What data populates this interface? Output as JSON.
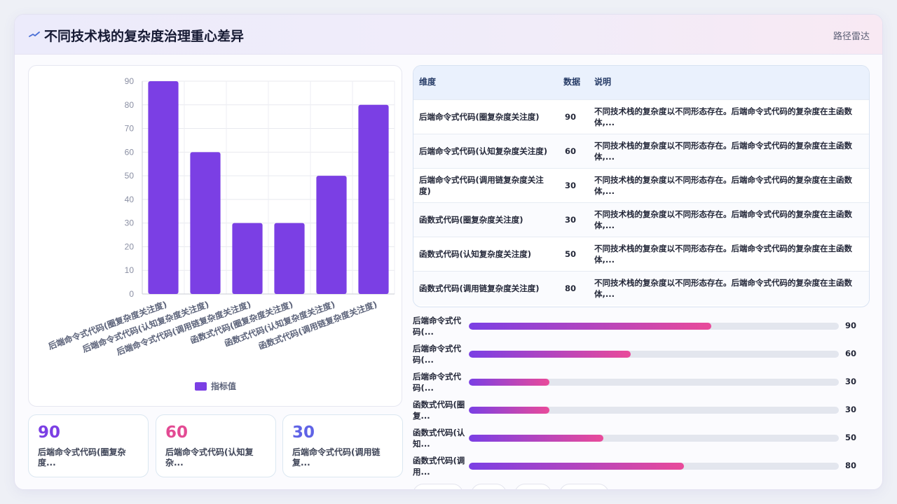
{
  "header": {
    "title": "不同技术栈的复杂度治理重心差异",
    "tag": "路径雷达"
  },
  "chart_data": {
    "type": "bar",
    "categories": [
      "后端命令式代码(圈复杂度关注度)",
      "后端命令式代码(认知复杂度关注度)",
      "后端命令式代码(调用链复杂度关注度)",
      "函数式代码(圈复杂度关注度)",
      "函数式代码(认知复杂度关注度)",
      "函数式代码(调用链复杂度关注度)"
    ],
    "series": [
      {
        "name": "指标值",
        "values": [
          90,
          60,
          30,
          30,
          50,
          80
        ]
      }
    ],
    "ylim": [
      0,
      90
    ],
    "yticks": [
      0,
      10,
      20,
      30,
      40,
      50,
      60,
      70,
      80,
      90
    ],
    "grid": true,
    "legend_position": "bottom",
    "bar_color": "#7b3fe4"
  },
  "stats": [
    {
      "value": "90",
      "label": "后端命令式代码(圈复杂度...",
      "color": "#7b3fe4"
    },
    {
      "value": "60",
      "label": "后端命令式代码(认知复杂...",
      "color": "#e34a93"
    },
    {
      "value": "30",
      "label": "后端命令式代码(调用链复...",
      "color": "#5f63e6"
    }
  ],
  "table": {
    "headers": {
      "dimension": "维度",
      "data": "数据",
      "description": "说明"
    },
    "rows": [
      {
        "dimension": "后端命令式代码(圈复杂度关注度)",
        "value": "90",
        "description": "不同技术栈的复杂度以不同形态存在。后端命令式代码的复杂度在主函数体,..."
      },
      {
        "dimension": "后端命令式代码(认知复杂度关注度)",
        "value": "60",
        "description": "不同技术栈的复杂度以不同形态存在。后端命令式代码的复杂度在主函数体,..."
      },
      {
        "dimension": "后端命令式代码(调用链复杂度关注度)",
        "value": "30",
        "description": "不同技术栈的复杂度以不同形态存在。后端命令式代码的复杂度在主函数体,..."
      },
      {
        "dimension": "函数式代码(圈复杂度关注度)",
        "value": "30",
        "description": "不同技术栈的复杂度以不同形态存在。后端命令式代码的复杂度在主函数体,..."
      },
      {
        "dimension": "函数式代码(认知复杂度关注度)",
        "value": "50",
        "description": "不同技术栈的复杂度以不同形态存在。后端命令式代码的复杂度在主函数体,..."
      },
      {
        "dimension": "函数式代码(调用链复杂度关注度)",
        "value": "80",
        "description": "不同技术栈的复杂度以不同形态存在。后端命令式代码的复杂度在主函数体,..."
      }
    ]
  },
  "progress": [
    {
      "label": "后端命令式代码(...",
      "value": "90",
      "fraction": 0.655
    },
    {
      "label": "后端命令式代码(...",
      "value": "60",
      "fraction": 0.437
    },
    {
      "label": "后端命令式代码(...",
      "value": "30",
      "fraction": 0.218
    },
    {
      "label": "函数式代码(圈复...",
      "value": "30",
      "fraction": 0.218
    },
    {
      "label": "函数式代码(认知...",
      "value": "50",
      "fraction": 0.364
    },
    {
      "label": "函数式代码(调用...",
      "value": "80",
      "fraction": 0.582
    }
  ]
}
